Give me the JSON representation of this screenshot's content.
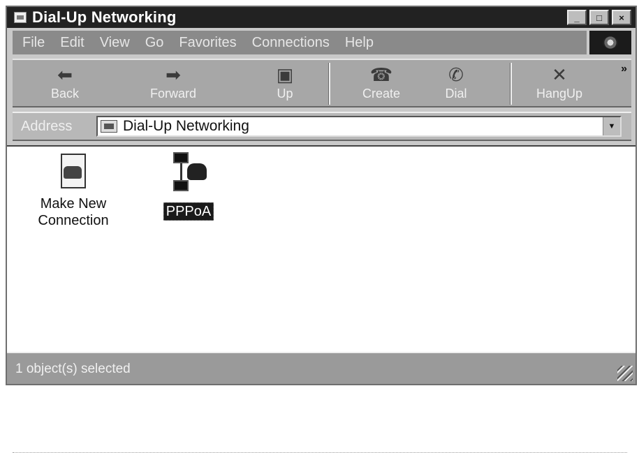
{
  "window": {
    "title": "Dial-Up Networking",
    "title_buttons": [
      {
        "name": "minimize",
        "glyph": "_"
      },
      {
        "name": "maximize",
        "glyph": "□"
      },
      {
        "name": "close",
        "glyph": "×"
      }
    ]
  },
  "menu": {
    "items": [
      "File",
      "Edit",
      "View",
      "Go",
      "Favorites",
      "Connections",
      "Help"
    ]
  },
  "toolbar": {
    "buttons": [
      {
        "label": "Back",
        "icon": "back-arrow-icon"
      },
      {
        "label": "Forward",
        "icon": "forward-arrow-icon"
      },
      {
        "label": "Up",
        "icon": "up-folder-icon"
      },
      {
        "label": "Create",
        "icon": "create-connection-icon"
      },
      {
        "label": "Dial",
        "icon": "dial-phone-icon"
      },
      {
        "label": "HangUp",
        "icon": "hangup-icon"
      }
    ],
    "overflow_glyph": "»"
  },
  "address": {
    "label": "Address",
    "value": "Dial-Up Networking",
    "dropdown_glyph": "▼"
  },
  "items": [
    {
      "label": "Make New Connection",
      "line1": "Make New",
      "line2": "Connection",
      "selected": false
    },
    {
      "label": "PPPoA",
      "selected": true
    }
  ],
  "status": {
    "text": "1 object(s) selected"
  },
  "colors": {
    "titlebar": "#222222",
    "frame": "#c9c9c9",
    "selection": "#1a1a1a"
  }
}
